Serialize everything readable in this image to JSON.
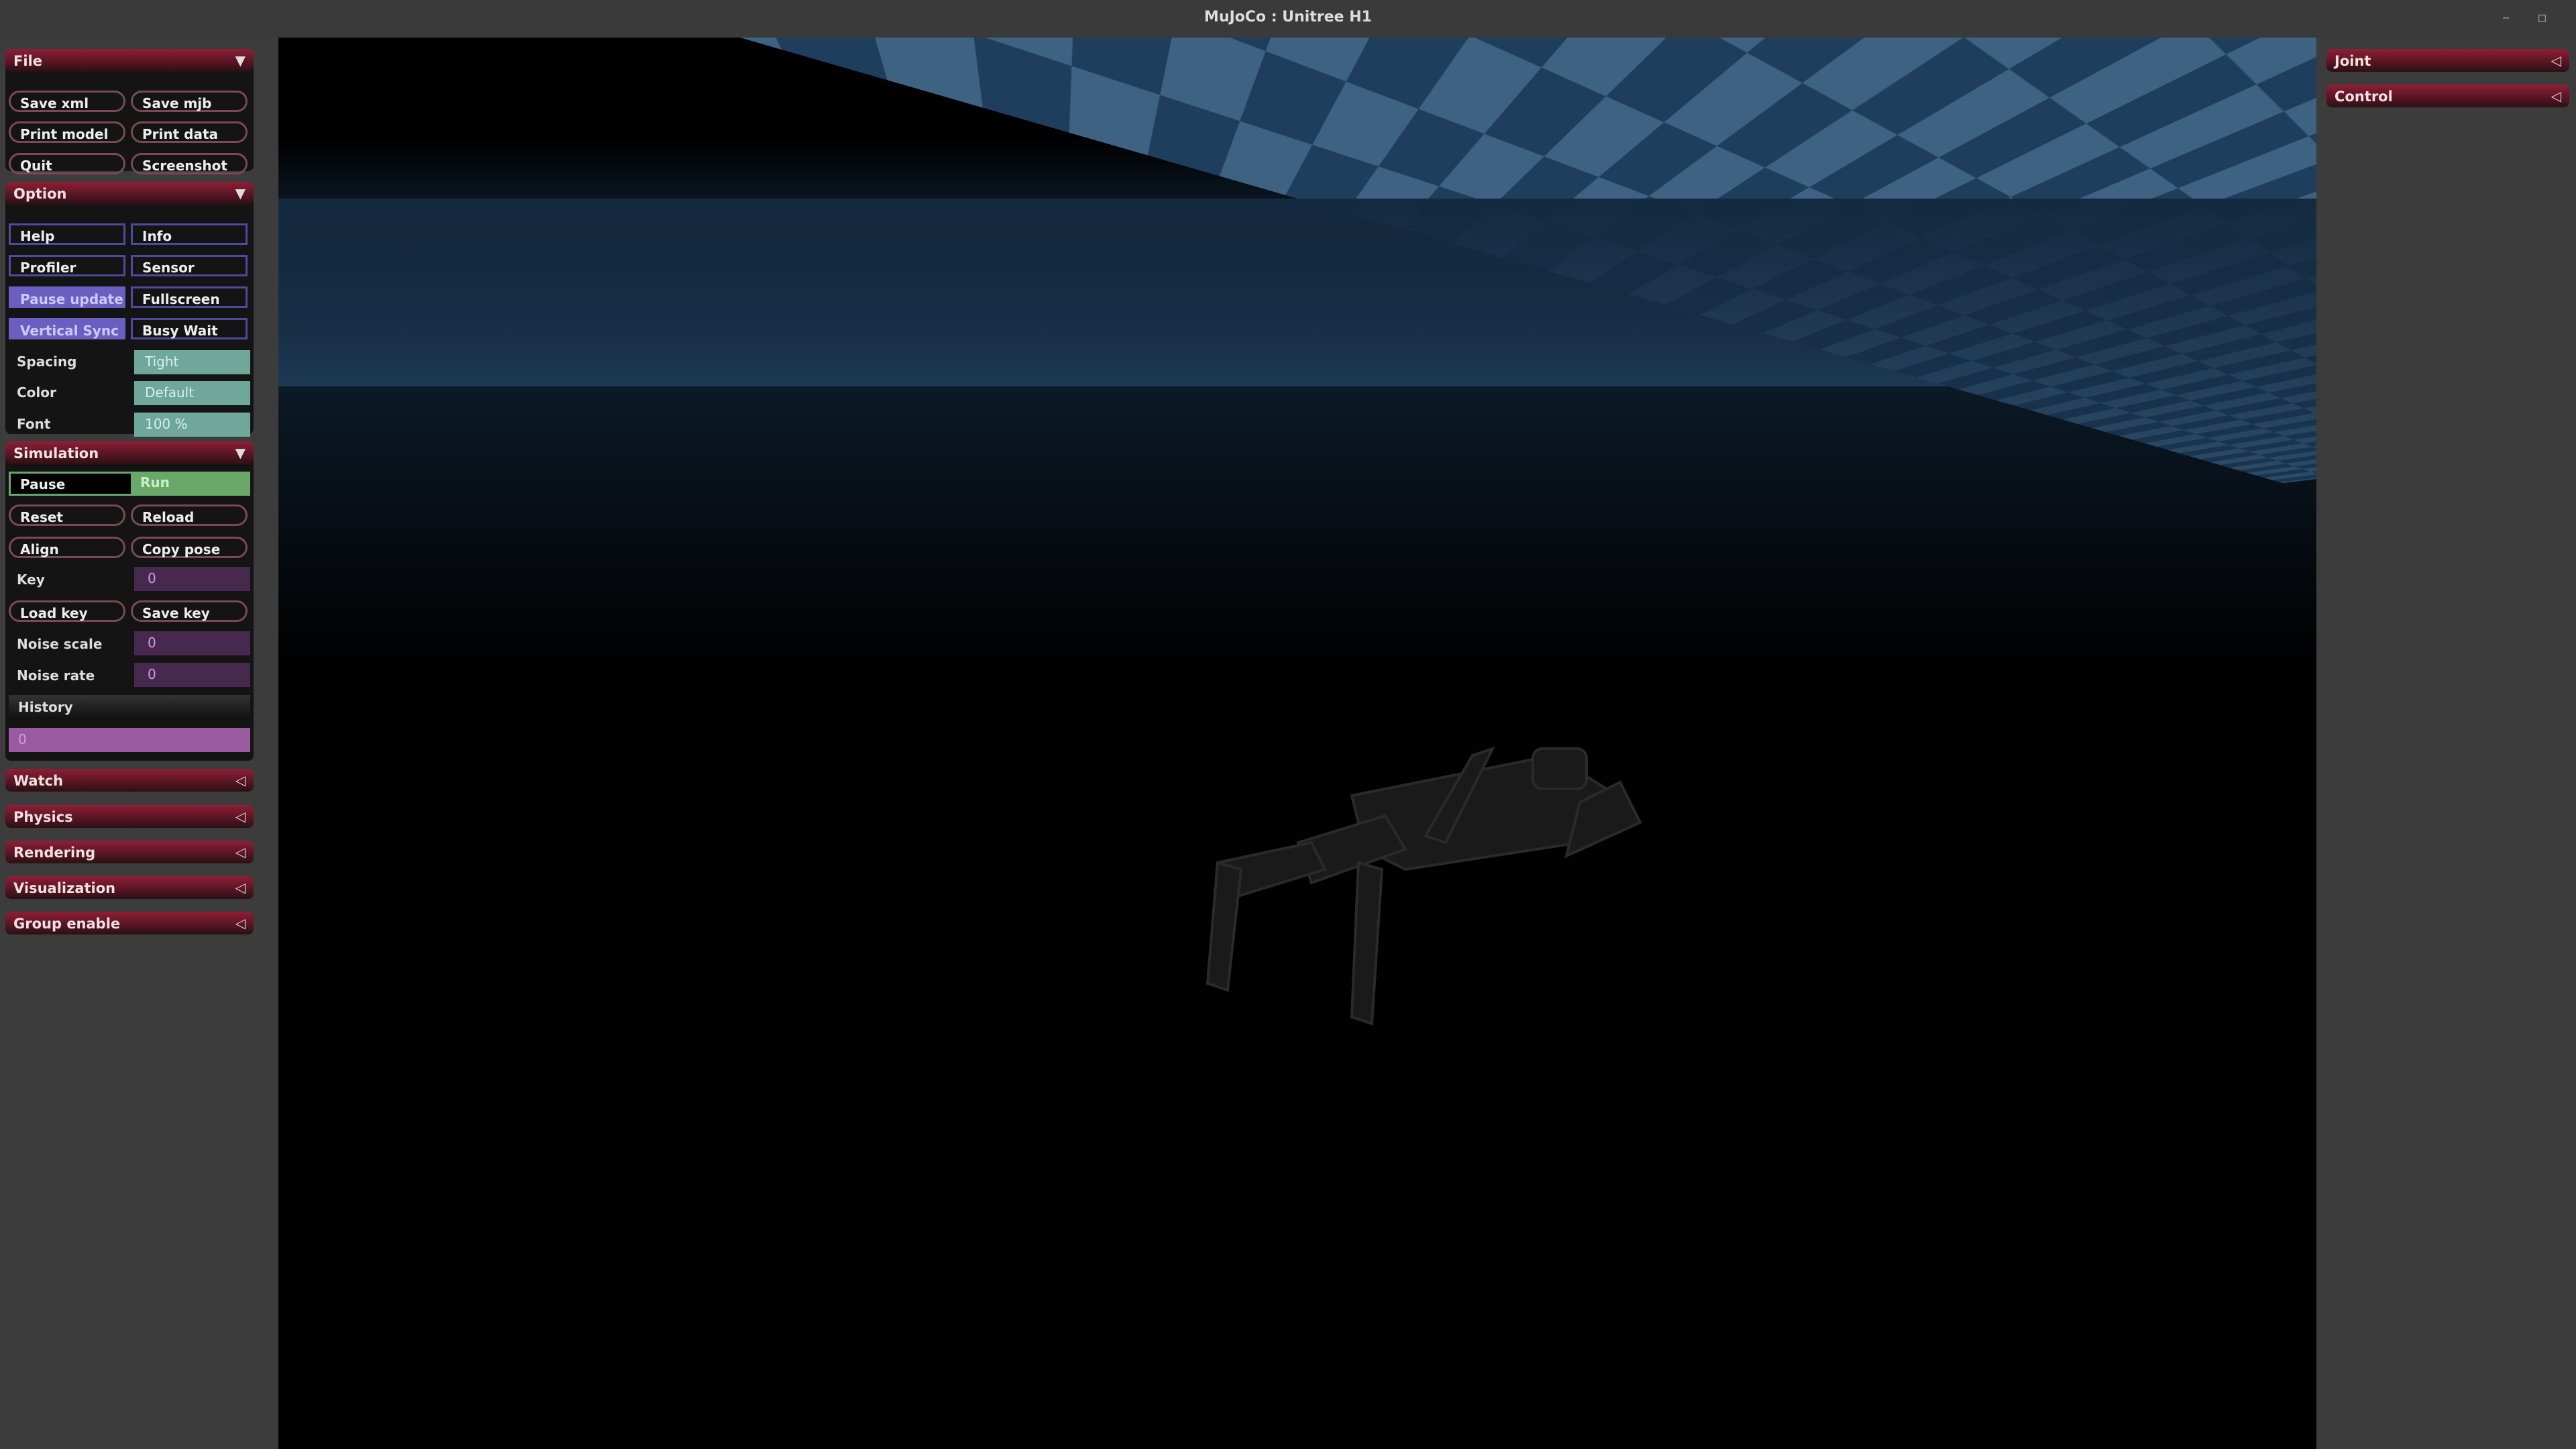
{
  "window": {
    "title": "MuJoCo : Unitree H1",
    "minimize": "–",
    "maximize": "▫"
  },
  "left_panel": {
    "file": {
      "title": "File",
      "buttons": [
        "Save xml",
        "Save mjb",
        "Print model",
        "Print data",
        "Quit",
        "Screenshot"
      ]
    },
    "option": {
      "title": "Option",
      "toggles": [
        {
          "label": "Help",
          "on": false
        },
        {
          "label": "Info",
          "on": false
        },
        {
          "label": "Profiler",
          "on": false
        },
        {
          "label": "Sensor",
          "on": false
        },
        {
          "label": "Pause update",
          "on": true
        },
        {
          "label": "Fullscreen",
          "on": false
        },
        {
          "label": "Vertical Sync",
          "on": true
        },
        {
          "label": "Busy Wait",
          "on": false
        }
      ],
      "selects": [
        {
          "label": "Spacing",
          "value": "Tight"
        },
        {
          "label": "Color",
          "value": "Default"
        },
        {
          "label": "Font",
          "value": "100 %"
        }
      ]
    },
    "simulation": {
      "title": "Simulation",
      "pause_label": "Pause",
      "run_label": "Run",
      "state": "Run",
      "buttons": [
        "Reset",
        "Reload",
        "Align",
        "Copy pose"
      ],
      "key_label": "Key",
      "key_value": "0",
      "load_key": "Load key",
      "save_key": "Save key",
      "noise_scale_label": "Noise scale",
      "noise_scale": "0",
      "noise_rate_label": "Noise rate",
      "noise_rate": "0",
      "history_label": "History",
      "history_value": "0"
    },
    "collapsed": [
      "Watch",
      "Physics",
      "Rendering",
      "Visualization",
      "Group enable"
    ]
  },
  "right_panel": {
    "collapsed": [
      "Joint",
      "Control"
    ]
  },
  "icons": {
    "expanded": "▼",
    "collapsed": "◁"
  },
  "colors": {
    "header": "#8e1f36",
    "toggle_on": "#6a5fc0",
    "select": "#6fa89a",
    "run": "#6aa86a",
    "numeric": "#47294f",
    "history": "#9a5aa0"
  }
}
